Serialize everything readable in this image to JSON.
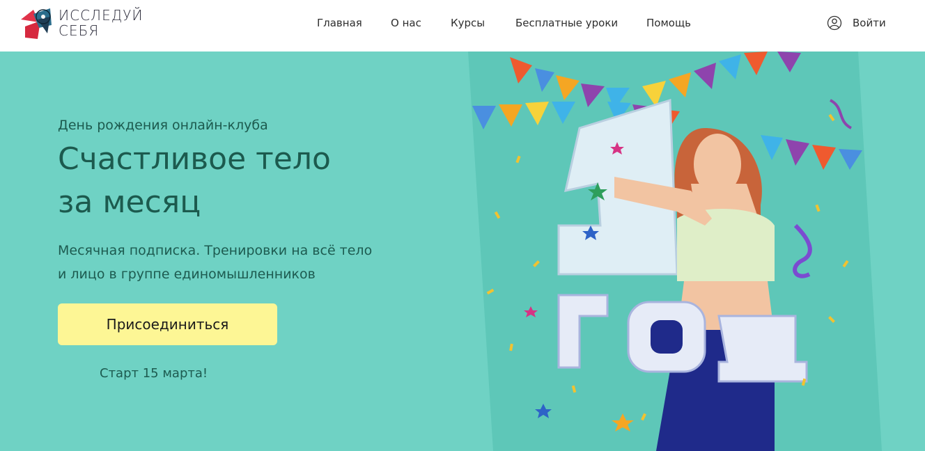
{
  "header": {
    "logo": {
      "line1": "ИССЛЕДУЙ",
      "line2": "СЕБЯ"
    },
    "nav": [
      {
        "label": "Главная",
        "name": "nav-home"
      },
      {
        "label": "О нас",
        "name": "nav-about"
      },
      {
        "label": "Курсы",
        "name": "nav-courses"
      },
      {
        "label": "Бесплатные уроки",
        "name": "nav-free-lessons"
      },
      {
        "label": "Помощь",
        "name": "nav-help"
      }
    ],
    "login_label": "Войти",
    "login_icon": "user-circle-icon"
  },
  "hero": {
    "eyebrow": "День рождения онлайн-клуба",
    "headline_line1": "Счастливое тело",
    "headline_line2": "за месяц",
    "subtitle_line1": "Месячная подписка. Тренировки на всё тело",
    "subtitle_line2": "и лицо в группе единомышленников",
    "cta_label": "Присоединиться",
    "start_note": "Старт 15 марта!",
    "badge_number": "1",
    "badge_word": "ГОД"
  },
  "colors": {
    "background": "#6fd2c4",
    "header_bg": "#ffffff",
    "headline": "#1c5a4e",
    "cta_bg": "#fdf695",
    "art_bg": "#5ec7b8"
  }
}
